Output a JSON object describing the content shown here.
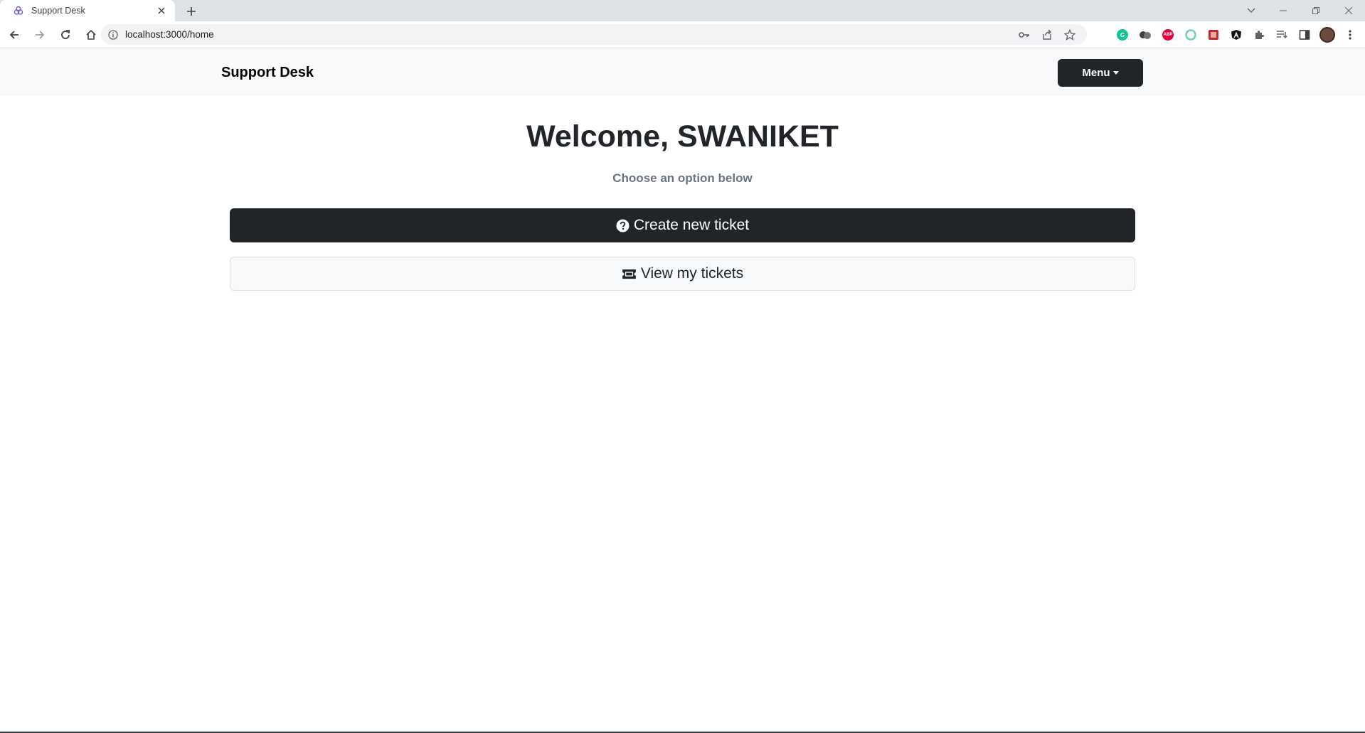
{
  "browser": {
    "tab_title": "Support Desk",
    "url": "localhost:3000/home"
  },
  "navbar": {
    "brand": "Support Desk",
    "menu_label": "Menu"
  },
  "main": {
    "welcome": "Welcome, SWANIKET",
    "subtitle": "Choose an option below",
    "create_label": "Create new ticket",
    "view_label": "View my tickets"
  },
  "icons": {
    "create": "question-circle-icon",
    "view": "ticket-icon"
  },
  "colors": {
    "primary_dark": "#212529",
    "navbar_bg": "#f8f9fa",
    "muted_text": "#6c757d"
  }
}
